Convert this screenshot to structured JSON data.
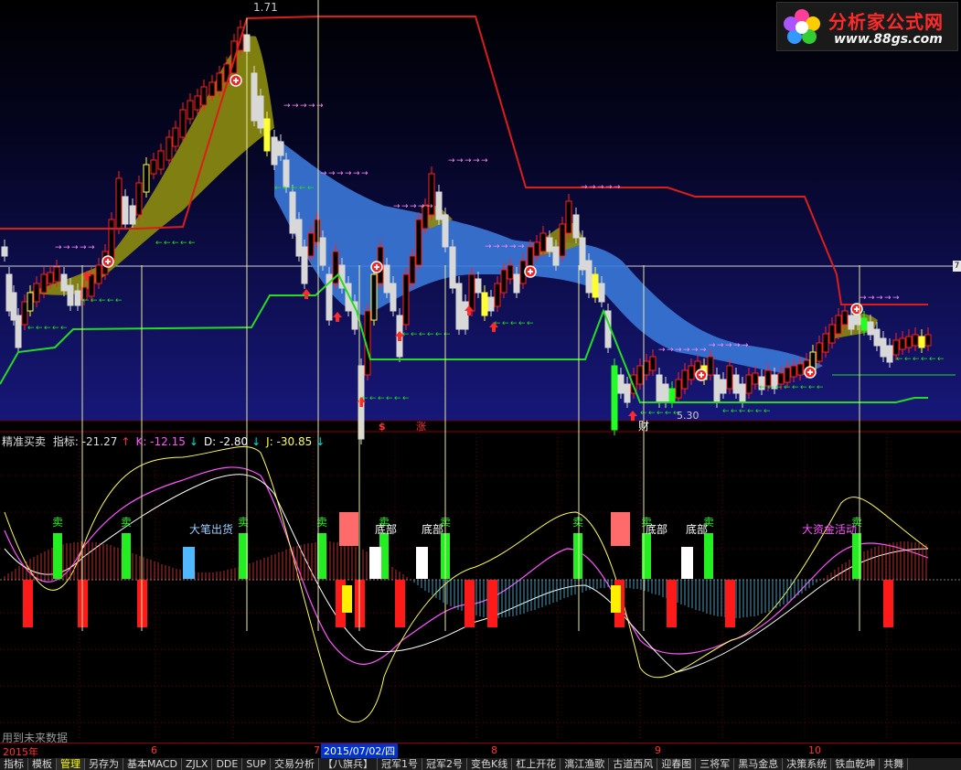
{
  "logo": {
    "title": "分析家公式网",
    "url": "www.88gs.com"
  },
  "main_chart": {
    "high_label": "1.71",
    "low_label": "5.30",
    "markers": [
      "$",
      "涨",
      "财"
    ]
  },
  "indicator": {
    "name": "精准买卖",
    "items": [
      {
        "label": "指标: -21.27",
        "color": "#dddddd",
        "arrow": "↑",
        "arrow_color": "#ff3333"
      },
      {
        "label": "K: -12.15",
        "color": "#ff55ff",
        "arrow": "↓",
        "arrow_color": "#00dddd"
      },
      {
        "label": "D: -2.80",
        "color": "#ffffff",
        "arrow": "↓",
        "arrow_color": "#00dddd"
      },
      {
        "label": "J: -30.85",
        "color": "#ffff55",
        "arrow": "↓",
        "arrow_color": "#00dddd"
      }
    ],
    "annotations": {
      "sell": "卖",
      "bottom": "底部",
      "big_sell": "大笔出货",
      "big_fund": "大资金活动"
    }
  },
  "future_data_note": "用到未来数据",
  "date_axis": {
    "year": "2015年",
    "months": [
      "6",
      "7",
      "8",
      "9",
      "10"
    ],
    "selected_date": "2015/07/02/四"
  },
  "bottom_tabs": [
    "指标",
    "模板",
    "管理",
    "另存为",
    "基本MACD",
    "ZJLX",
    "DDE",
    "SUP",
    "交易分析",
    "【八旗兵】",
    "冠军1号",
    "冠军2号",
    "变色K线",
    "杠上开花",
    "漓江渔歌",
    "古道西风",
    "迎春图",
    "三将军",
    "黑马金息",
    "决策系统",
    "铁血乾坤",
    "共舞"
  ],
  "active_tab": "管理",
  "colors": {
    "up": "#ff2020",
    "down": "#00ffff",
    "bg": "#000000",
    "band_blue": "#3a78d8",
    "band_olive": "#8a8a10",
    "support": "#22dd22",
    "resistance": "#dd1c1c"
  }
}
